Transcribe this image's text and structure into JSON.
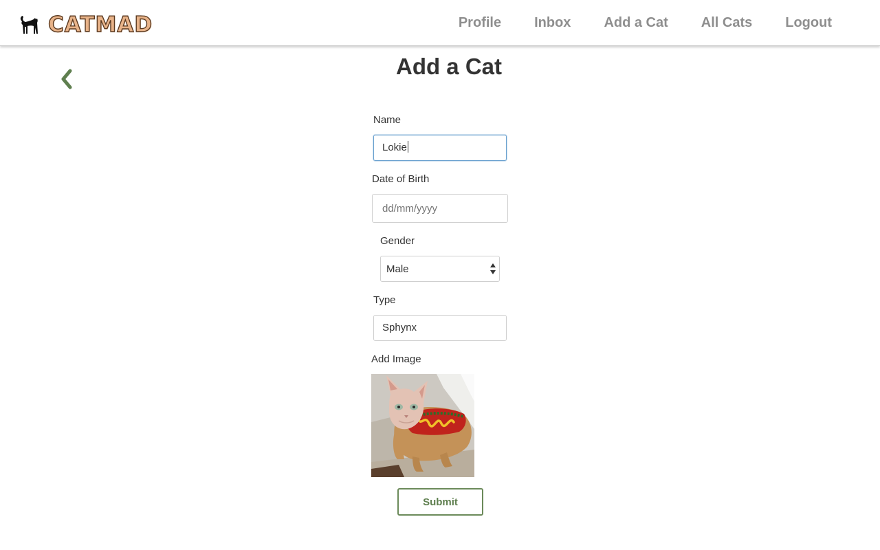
{
  "brand": {
    "wordmark": "CATMAD",
    "logo_icon": "black-cat-icon"
  },
  "nav": {
    "items": [
      {
        "label": "Profile"
      },
      {
        "label": "Inbox"
      },
      {
        "label": "Add a Cat"
      },
      {
        "label": "All Cats"
      },
      {
        "label": "Logout"
      }
    ],
    "link_color": "#8e8e8e"
  },
  "back": {
    "icon": "chevron-left-icon",
    "color": "#5f7f4f"
  },
  "page": {
    "title": "Add a Cat"
  },
  "form": {
    "name": {
      "label": "Name",
      "value": "Lokie"
    },
    "dob": {
      "label": "Date of Birth",
      "placeholder": "dd/mm/yyyy"
    },
    "gender": {
      "label": "Gender",
      "selected": "Male"
    },
    "type": {
      "label": "Type",
      "value": "Sphynx"
    },
    "image": {
      "label": "Add Image",
      "description": "sphynx-cat-in-hotdog-costume-photo"
    },
    "submit_label": "Submit"
  },
  "colors": {
    "accent": "#6b8a5a",
    "focus_border": "#6aa1cf",
    "title": "#333333"
  }
}
